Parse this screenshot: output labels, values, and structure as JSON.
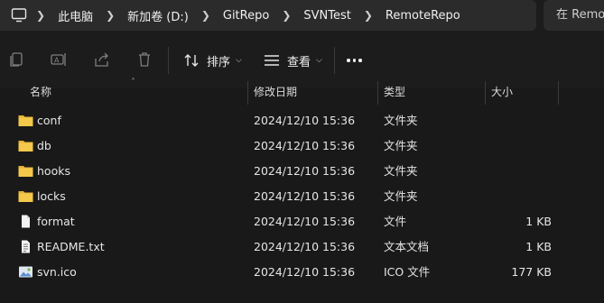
{
  "address_bar": {
    "breadcrumbs": [
      "此电脑",
      "新加卷 (D:)",
      "GitRepo",
      "SVNTest",
      "RemoteRepo"
    ],
    "search_placeholder": "在 Remote"
  },
  "toolbar": {
    "sort_label": "排序",
    "view_label": "查看"
  },
  "columns": {
    "name": "名称",
    "date": "修改日期",
    "type": "类型",
    "size": "大小"
  },
  "files": [
    {
      "name": "conf",
      "date": "2024/12/10 15:36",
      "type": "文件夹",
      "size": "",
      "icon": "folder-icon"
    },
    {
      "name": "db",
      "date": "2024/12/10 15:36",
      "type": "文件夹",
      "size": "",
      "icon": "folder-icon"
    },
    {
      "name": "hooks",
      "date": "2024/12/10 15:36",
      "type": "文件夹",
      "size": "",
      "icon": "folder-icon"
    },
    {
      "name": "locks",
      "date": "2024/12/10 15:36",
      "type": "文件夹",
      "size": "",
      "icon": "folder-icon"
    },
    {
      "name": "format",
      "date": "2024/12/10 15:36",
      "type": "文件",
      "size": "1 KB",
      "icon": "file-icon"
    },
    {
      "name": "README.txt",
      "date": "2024/12/10 15:36",
      "type": "文本文档",
      "size": "1 KB",
      "icon": "text-file-icon"
    },
    {
      "name": "svn.ico",
      "date": "2024/12/10 15:36",
      "type": "ICO 文件",
      "size": "177 KB",
      "icon": "image-file-icon"
    }
  ],
  "colors": {
    "background": "#191919",
    "address_bg": "#2b2b2b",
    "folder": "#f4c84a"
  }
}
